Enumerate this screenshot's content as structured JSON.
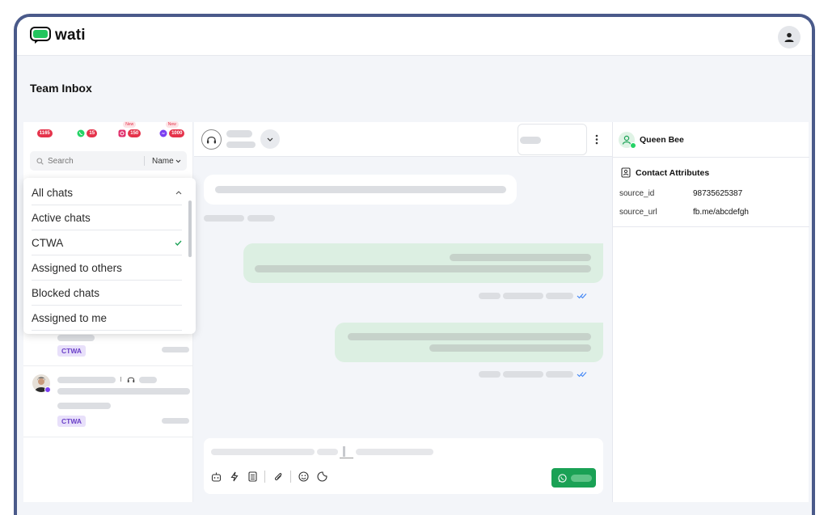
{
  "app": {
    "name": "wati"
  },
  "page": {
    "title": "Team Inbox"
  },
  "tabs": [
    {
      "name": "all",
      "badge": "1165",
      "new": ""
    },
    {
      "name": "whatsapp",
      "badge": "15",
      "new": ""
    },
    {
      "name": "instagram",
      "badge": "150",
      "new": "New"
    },
    {
      "name": "messenger",
      "badge": "1000",
      "new": "New"
    }
  ],
  "search": {
    "placeholder": "Search",
    "sort_label": "Name"
  },
  "filter_menu": {
    "items": [
      "All chats",
      "Active chats",
      "CTWA",
      "Assigned to others",
      "Blocked chats",
      "Assigned to me"
    ],
    "selected": "CTWA"
  },
  "chat_list": [
    {
      "tag": "CTWA"
    },
    {
      "tag": "CTWA"
    }
  ],
  "contact": {
    "name": "Queen Bee",
    "attributes_title": "Contact Attributes",
    "attributes": [
      {
        "key": "source_id",
        "value": "98735625387"
      },
      {
        "key": "source_url",
        "value": "fb.me/abcdefgh"
      }
    ]
  },
  "colors": {
    "brand_green": "#1aa155",
    "badge_red": "#e5334b",
    "tag_purple": "#6a3fc8",
    "frame": "#4a5a8a"
  }
}
